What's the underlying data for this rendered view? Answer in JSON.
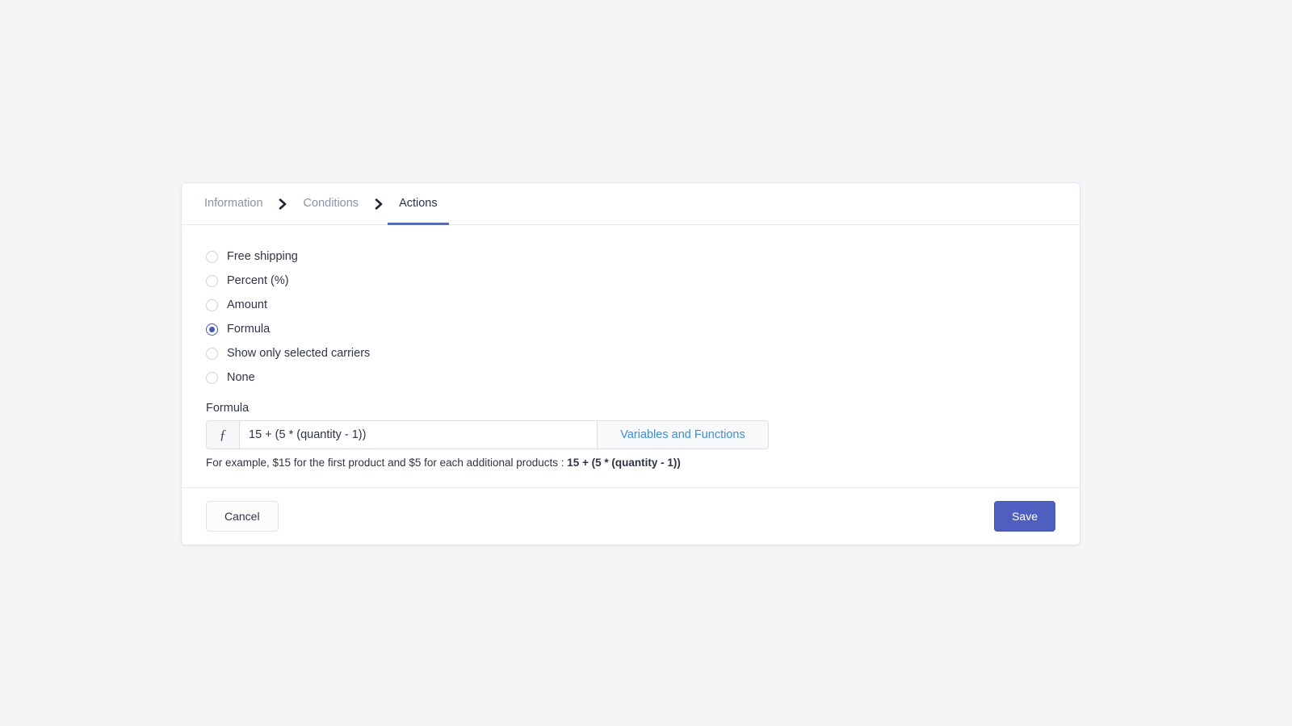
{
  "page": {
    "background_color": "#f4f5f7",
    "accent_color": "#4f5fbf",
    "link_color": "#3e8ed8"
  },
  "breadcrumb": {
    "separator_icon": "chevron-right-icon",
    "steps": [
      {
        "label": "Information",
        "active": false
      },
      {
        "label": "Conditions",
        "active": false
      },
      {
        "label": "Actions",
        "active": true
      }
    ]
  },
  "actions": {
    "options": [
      {
        "label": "Free shipping",
        "selected": false
      },
      {
        "label": "Percent (%)",
        "selected": false
      },
      {
        "label": "Amount",
        "selected": false
      },
      {
        "label": "Formula",
        "selected": true
      },
      {
        "label": "Show only selected carriers",
        "selected": false
      },
      {
        "label": "None",
        "selected": false
      }
    ]
  },
  "formula_field": {
    "label": "Formula",
    "prefix_icon": "function-icon",
    "prefix_glyph": "ƒ",
    "value": "15 + (5 * (quantity - 1))",
    "placeholder": "",
    "suffix_button_label": "Variables and Functions",
    "hint_prefix": "For example, $15 for the first product and $5 for each additional products : ",
    "hint_strong": "15 + (5 * (quantity - 1))"
  },
  "footer": {
    "cancel_label": "Cancel",
    "save_label": "Save"
  }
}
